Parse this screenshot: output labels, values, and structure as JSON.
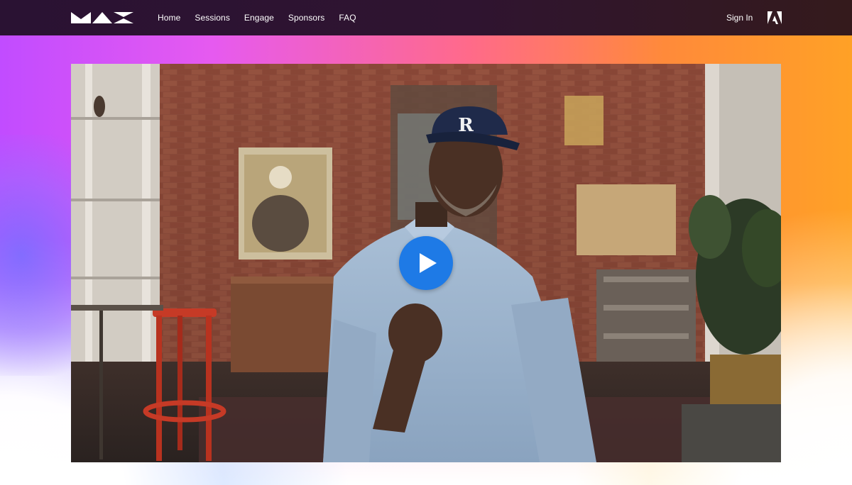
{
  "header": {
    "logo_name": "MAX",
    "nav": [
      "Home",
      "Sessions",
      "Engage",
      "Sponsors",
      "FAQ"
    ],
    "sign_in_label": "Sign In",
    "brand_icon": "adobe-logo-icon"
  },
  "video": {
    "play_icon": "play-icon",
    "accent": "#1e7ae6"
  },
  "colors": {
    "nav_background": "#2a1233",
    "gradient": [
      "#c14cff",
      "#ff6a8a",
      "#ffa126"
    ]
  }
}
